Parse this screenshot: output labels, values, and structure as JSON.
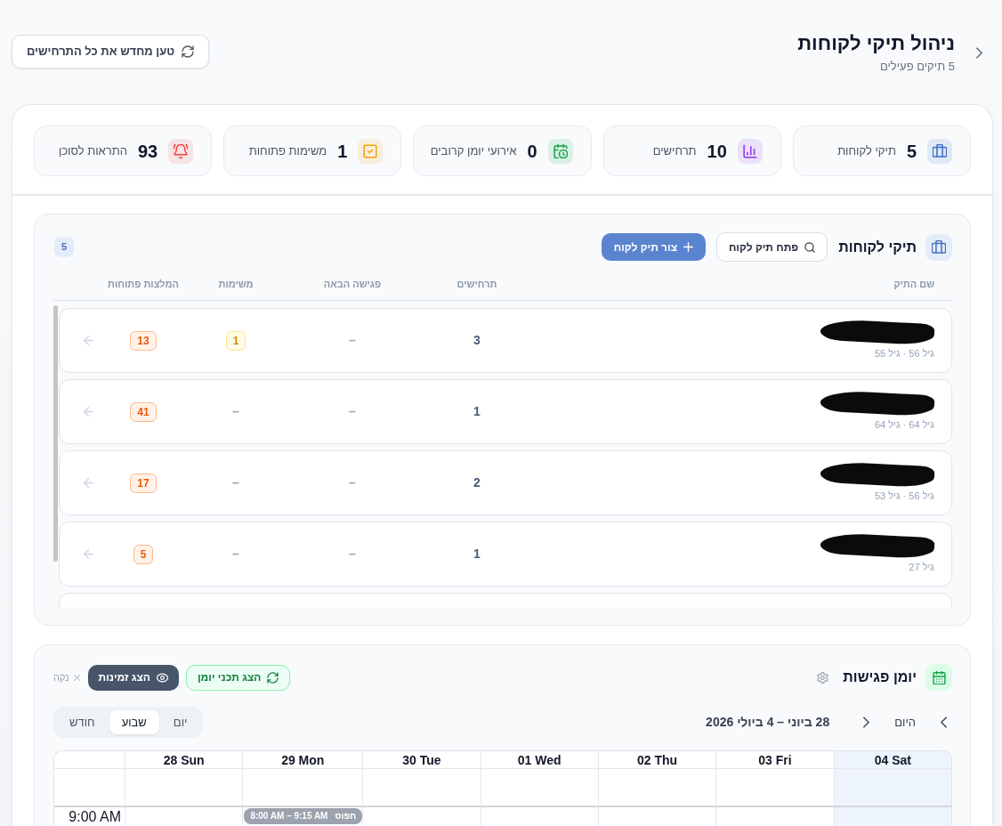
{
  "header": {
    "title": "ניהול תיקי לקוחות",
    "subtitle": "5 תיקים פעילים",
    "reload_button": "טען מחדש את כל התרחישים"
  },
  "stats": [
    {
      "value": "5",
      "label": "תיקי לקוחות",
      "kind": "briefcase",
      "color": "#3b6fc9"
    },
    {
      "value": "10",
      "label": "תרחישים",
      "kind": "chart",
      "color": "#9333ea"
    },
    {
      "value": "0",
      "label": "אירועי יומן קרובים",
      "kind": "calendar",
      "color": "#16a34a"
    },
    {
      "value": "1",
      "label": "משימות פתוחות",
      "kind": "task",
      "color": "#f59e0b"
    },
    {
      "value": "93",
      "label": "התראות לסוכן",
      "kind": "bell",
      "color": "#ef4444"
    }
  ],
  "portfolios": {
    "title": "תיקי לקוחות",
    "search_button": "פתח תיק לקוח",
    "create_button": "צור תיק לקוח",
    "count": "5",
    "columns": [
      "שם התיק",
      "תרחישים",
      "פגישה הבאה",
      "משימות",
      "המלצות פתוחות"
    ],
    "rows": [
      {
        "subtitle": "גיל 56 · גיל 55",
        "scenarios": "3",
        "next_meeting": "–",
        "tasks": {
          "text": "1",
          "kind": "badge"
        },
        "recommendations": {
          "text": "13",
          "kind": "badge"
        }
      },
      {
        "subtitle": "גיל 64 · גיל 64",
        "scenarios": "1",
        "next_meeting": "–",
        "tasks": {
          "text": "–",
          "kind": "empty"
        },
        "recommendations": {
          "text": "41",
          "kind": "badge"
        }
      },
      {
        "subtitle": "גיל 56 · גיל 53",
        "scenarios": "2",
        "next_meeting": "–",
        "tasks": {
          "text": "–",
          "kind": "empty"
        },
        "recommendations": {
          "text": "17",
          "kind": "badge"
        }
      },
      {
        "subtitle": "גיל 27",
        "scenarios": "1",
        "next_meeting": "–",
        "tasks": {
          "text": "–",
          "kind": "empty"
        },
        "recommendations": {
          "text": "5",
          "kind": "badge"
        }
      }
    ]
  },
  "calendar": {
    "title": "יומן פגישות",
    "show_content_button": "הצג תכני יומן",
    "availability_button": "הצג זמינות",
    "clear_button": "נקה",
    "today_button": "היום",
    "range": "28 ביוני – 4 ביולי 2026",
    "views": [
      {
        "label": "יום",
        "selected": false
      },
      {
        "label": "שבוע",
        "selected": true
      },
      {
        "label": "חודש",
        "selected": false
      }
    ],
    "days": [
      {
        "label": "04 Sat",
        "highlighted": true
      },
      {
        "label": "03 Fri",
        "highlighted": false
      },
      {
        "label": "02 Thu",
        "highlighted": false
      },
      {
        "label": "01 Wed",
        "highlighted": false
      },
      {
        "label": "30 Tue",
        "highlighted": false
      },
      {
        "label": "29 Mon",
        "highlighted": false,
        "events": [
          {
            "time": "8:00 AM – 9:15 AM",
            "title": "תפוס"
          }
        ]
      },
      {
        "label": "28 Sun",
        "highlighted": false
      }
    ],
    "time_slots": [
      "9:00 AM"
    ]
  }
}
